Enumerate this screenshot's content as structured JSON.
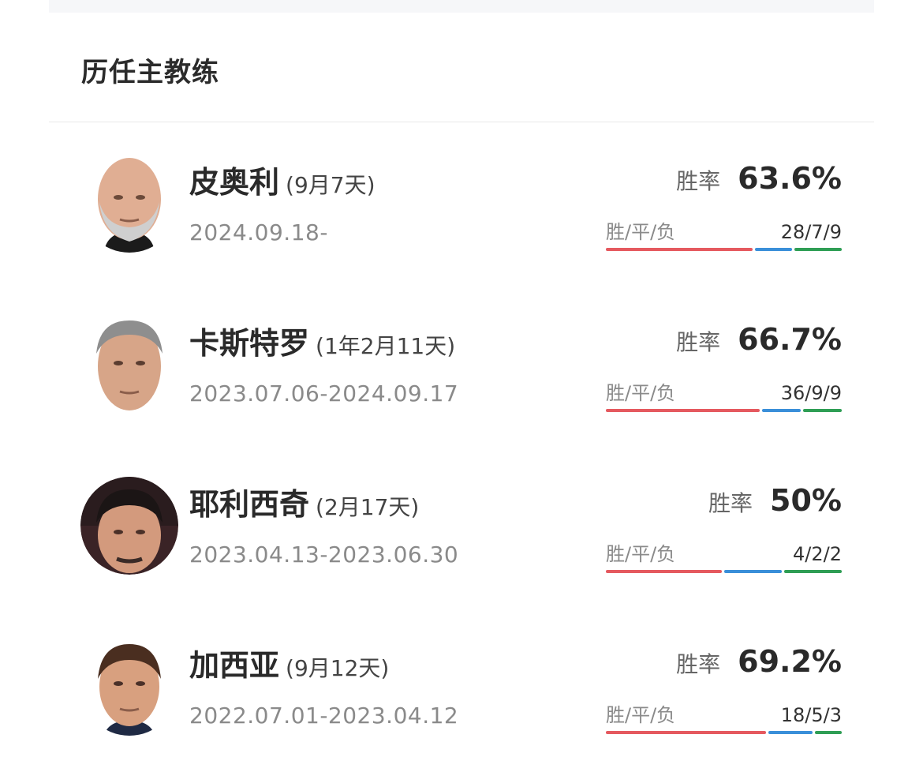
{
  "section": {
    "title": "历任主教练"
  },
  "labels": {
    "winrate": "胜率",
    "record": "胜/平/负"
  },
  "colors": {
    "win": "#e5595f",
    "draw": "#3a8fd9",
    "loss": "#2f9e55"
  },
  "coaches": [
    {
      "name": "皮奥利",
      "tenure": "(9月7天)",
      "period": "2024.09.18-",
      "winrate": "63.6%",
      "record": "28/7/9",
      "wins": 28,
      "draws": 7,
      "losses": 9,
      "avatar": "coach-photo-bald-grey-beard"
    },
    {
      "name": "卡斯特罗",
      "tenure": "(1年2月11天)",
      "period": "2023.07.06-2024.09.17",
      "winrate": "66.7%",
      "record": "36/9/9",
      "wins": 36,
      "draws": 9,
      "losses": 9,
      "avatar": "coach-photo-grey-hair"
    },
    {
      "name": "耶利西奇",
      "tenure": "(2月17天)",
      "period": "2023.04.13-2023.06.30",
      "winrate": "50%",
      "record": "4/2/2",
      "wins": 4,
      "draws": 2,
      "losses": 2,
      "avatar": "coach-photo-dark-hair"
    },
    {
      "name": "加西亚",
      "tenure": "(9月12天)",
      "period": "2022.07.01-2023.04.12",
      "winrate": "69.2%",
      "record": "18/5/3",
      "wins": 18,
      "draws": 5,
      "losses": 3,
      "avatar": "coach-photo-brown-hair-suit"
    }
  ]
}
